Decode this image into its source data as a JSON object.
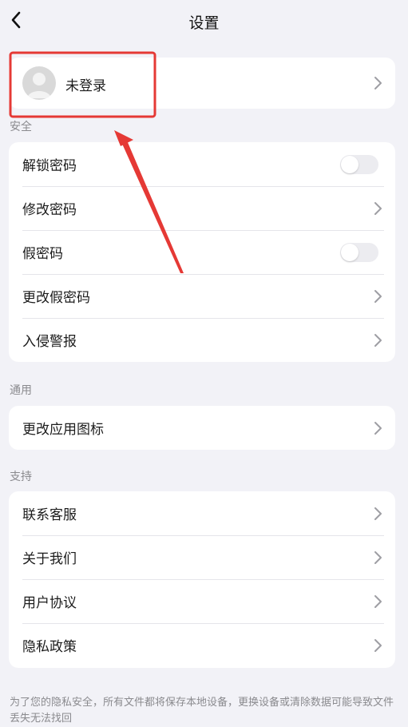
{
  "nav": {
    "title": "设置",
    "back_icon": "chevron-left-icon"
  },
  "account": {
    "label": "未登录",
    "avatar_icon": "user-avatar-icon"
  },
  "security": {
    "header": "安全",
    "items": [
      {
        "label": "解锁密码",
        "control": "toggle",
        "on": false
      },
      {
        "label": "修改密码",
        "control": "chevron"
      },
      {
        "label": "假密码",
        "control": "toggle",
        "on": false
      },
      {
        "label": "更改假密码",
        "control": "chevron"
      },
      {
        "label": "入侵警报",
        "control": "chevron"
      }
    ]
  },
  "general": {
    "header": "通用",
    "items": [
      {
        "label": "更改应用图标",
        "control": "chevron"
      }
    ]
  },
  "support": {
    "header": "支持",
    "items": [
      {
        "label": "联系客服",
        "control": "chevron"
      },
      {
        "label": "关于我们",
        "control": "chevron"
      },
      {
        "label": "用户协议",
        "control": "chevron"
      },
      {
        "label": "隐私政策",
        "control": "chevron"
      }
    ]
  },
  "footer": {
    "text": "为了您的隐私安全，所有文件都将保存本地设备，更换设备或清除数据可能导致文件丢失无法找回"
  },
  "annotation": {
    "color": "#e53935"
  }
}
